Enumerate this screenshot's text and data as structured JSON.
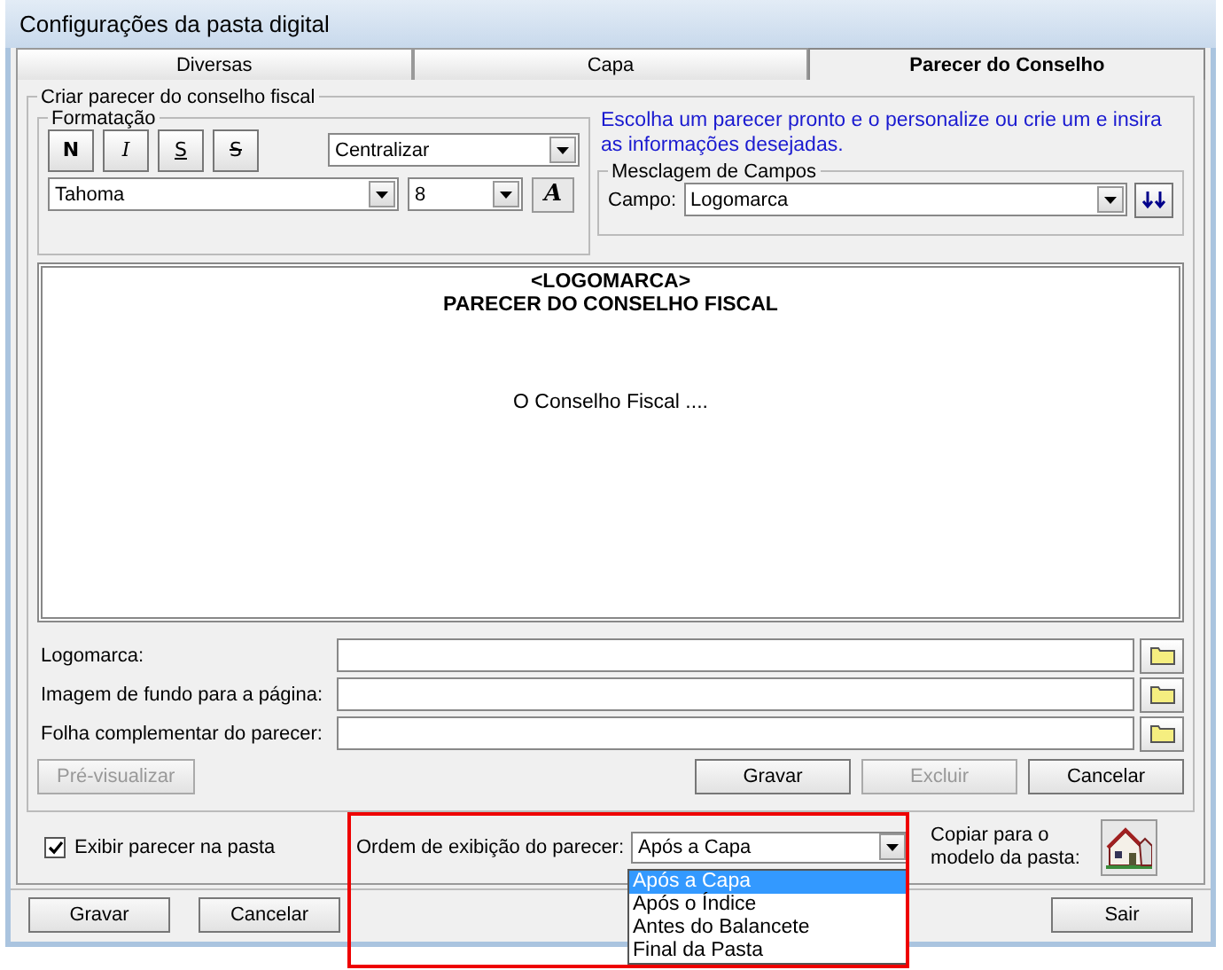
{
  "window": {
    "title": "Configurações da pasta digital"
  },
  "tabs": [
    {
      "label": "Diversas",
      "selected": false
    },
    {
      "label": "Capa",
      "selected": false
    },
    {
      "label": "Parecer do Conselho",
      "selected": true
    }
  ],
  "group": {
    "title": "Criar parecer do conselho fiscal",
    "formatting": {
      "title": "Formatação",
      "style_buttons": [
        {
          "label": "N",
          "kind": "bold"
        },
        {
          "label": "I",
          "kind": "italic"
        },
        {
          "label": "S",
          "kind": "underline"
        },
        {
          "label": "S",
          "kind": "strike"
        }
      ],
      "alignment": "Centralizar",
      "font": "Tahoma",
      "size": "8",
      "font_button": "A"
    },
    "hint": "Escolha um parecer pronto e o personalize ou crie um e insira as informações desejadas.",
    "merge": {
      "title": "Mesclagem de Campos",
      "label": "Campo:",
      "value": "Logomarca"
    },
    "editor": {
      "lines": [
        {
          "text": "<LOGOMARCA>",
          "kind": "heading"
        },
        {
          "text": "PARECER DO CONSELHO FISCAL",
          "kind": "heading"
        },
        {
          "text": "O Conselho Fiscal ....",
          "kind": "body"
        }
      ]
    },
    "fields": [
      {
        "label": "Logomarca:"
      },
      {
        "label": "Imagem de fundo para a página:"
      },
      {
        "label": "Folha complementar do parecer:"
      }
    ],
    "buttons": [
      {
        "label": "Pré-visualizar",
        "disabled": true,
        "kind": "left"
      },
      {
        "label": "Gravar",
        "disabled": false,
        "kind": "right"
      },
      {
        "label": "Excluir",
        "disabled": true,
        "kind": "right"
      },
      {
        "label": "Cancelar",
        "disabled": false,
        "kind": "right"
      }
    ]
  },
  "show_in_folder": {
    "label": "Exibir parecer na pasta",
    "checked": true
  },
  "order": {
    "label": "Ordem de exibição do parecer:",
    "value": "Após a Capa",
    "options": [
      {
        "label": "Após a Capa",
        "selected": true
      },
      {
        "label": "Após o Índice",
        "selected": false
      },
      {
        "label": "Antes do Balancete",
        "selected": false
      },
      {
        "label": "Final da Pasta",
        "selected": false
      }
    ]
  },
  "copy": {
    "label": "Copiar para o modelo da pasta:"
  },
  "footer_buttons": [
    {
      "label": "Gravar",
      "kind": "left"
    },
    {
      "label": "Cancelar",
      "kind": "left"
    },
    {
      "label": "Sair",
      "kind": "right"
    }
  ]
}
